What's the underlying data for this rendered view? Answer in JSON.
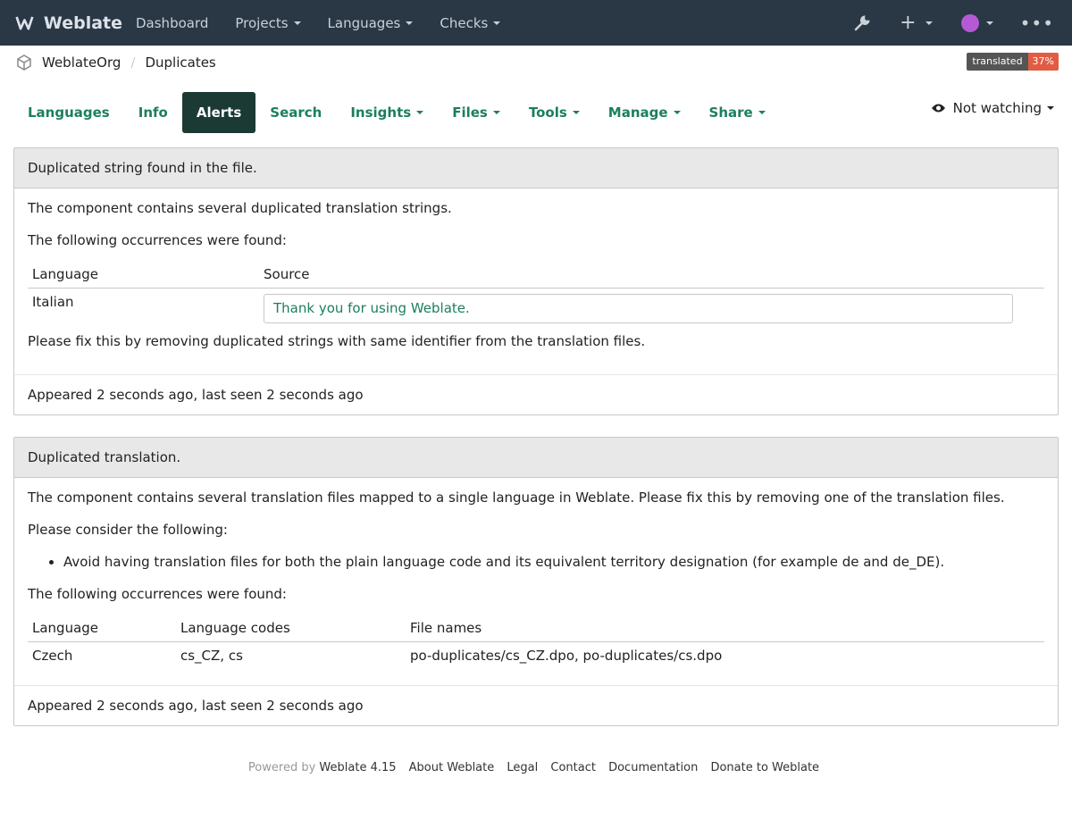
{
  "brand": {
    "name": "Weblate"
  },
  "nav": {
    "items": [
      {
        "label": "Dashboard",
        "caret": false
      },
      {
        "label": "Projects",
        "caret": true
      },
      {
        "label": "Languages",
        "caret": true
      },
      {
        "label": "Checks",
        "caret": true
      }
    ]
  },
  "breadcrumb": {
    "org": "WeblateOrg",
    "component": "Duplicates"
  },
  "badge": {
    "label": "translated",
    "value": "37%"
  },
  "tabs": [
    {
      "label": "Languages",
      "caret": false
    },
    {
      "label": "Info",
      "caret": false
    },
    {
      "label": "Alerts",
      "caret": false,
      "active": true
    },
    {
      "label": "Search",
      "caret": false
    },
    {
      "label": "Insights",
      "caret": true
    },
    {
      "label": "Files",
      "caret": true
    },
    {
      "label": "Tools",
      "caret": true
    },
    {
      "label": "Manage",
      "caret": true
    },
    {
      "label": "Share",
      "caret": true
    }
  ],
  "watch": {
    "label": "Not watching"
  },
  "alert1": {
    "title": "Duplicated string found in the file.",
    "desc": "The component contains several duplicated translation strings.",
    "occ_label": "The following occurrences were found:",
    "headers": {
      "language": "Language",
      "source": "Source"
    },
    "rows": [
      {
        "language": "Italian",
        "source": "Thank you for using Weblate."
      }
    ],
    "fix": "Please fix this by removing duplicated strings with same identifier from the translation files.",
    "footer": "Appeared 2 seconds ago, last seen 2 seconds ago"
  },
  "alert2": {
    "title": "Duplicated translation.",
    "desc": "The component contains several translation files mapped to a single language in Weblate. Please fix this by removing one of the translation files.",
    "consider": "Please consider the following:",
    "bullet": "Avoid having translation files for both the plain language code and its equivalent territory designation (for example de and de_DE).",
    "occ_label": "The following occurrences were found:",
    "headers": {
      "language": "Language",
      "codes": "Language codes",
      "files": "File names"
    },
    "rows": [
      {
        "language": "Czech",
        "codes": "cs_CZ, cs",
        "files": "po-duplicates/cs_CZ.dpo, po-duplicates/cs.dpo"
      }
    ],
    "footer": "Appeared 2 seconds ago, last seen 2 seconds ago"
  },
  "footer": {
    "powered": "Powered by",
    "version": "Weblate 4.15",
    "links": [
      "About Weblate",
      "Legal",
      "Contact",
      "Documentation",
      "Donate to Weblate"
    ]
  },
  "colors": {
    "navbar": "#2a3744",
    "accent": "#1c7e61",
    "active_tab": "#1b3a34",
    "badge_value": "#e05d44"
  }
}
